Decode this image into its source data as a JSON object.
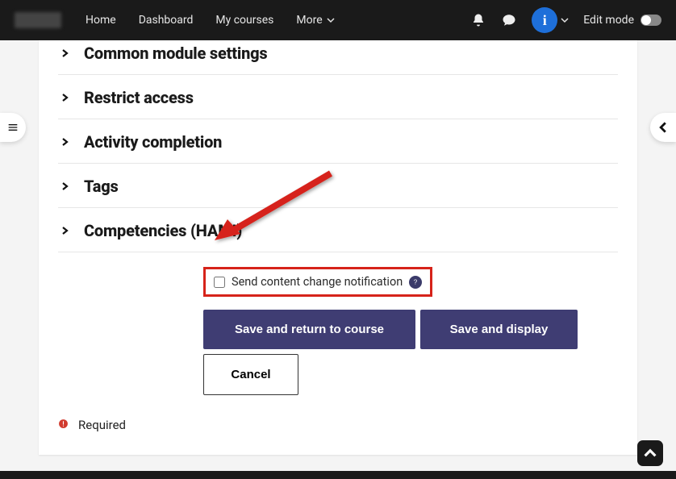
{
  "navbar": {
    "links": {
      "home": "Home",
      "dashboard": "Dashboard",
      "mycourses": "My courses",
      "more": "More"
    },
    "edit_mode_label": "Edit mode",
    "avatar_letter": "i"
  },
  "sections": {
    "common_module": "Common module settings",
    "restrict_access": "Restrict access",
    "activity_completion": "Activity completion",
    "tags": "Tags",
    "competencies": "Competencies (HAMI)"
  },
  "notify": {
    "label": "Send content change notification",
    "help_char": "?"
  },
  "buttons": {
    "save_return": "Save and return to course",
    "save_display": "Save and display",
    "cancel": "Cancel"
  },
  "required_label": "Required"
}
